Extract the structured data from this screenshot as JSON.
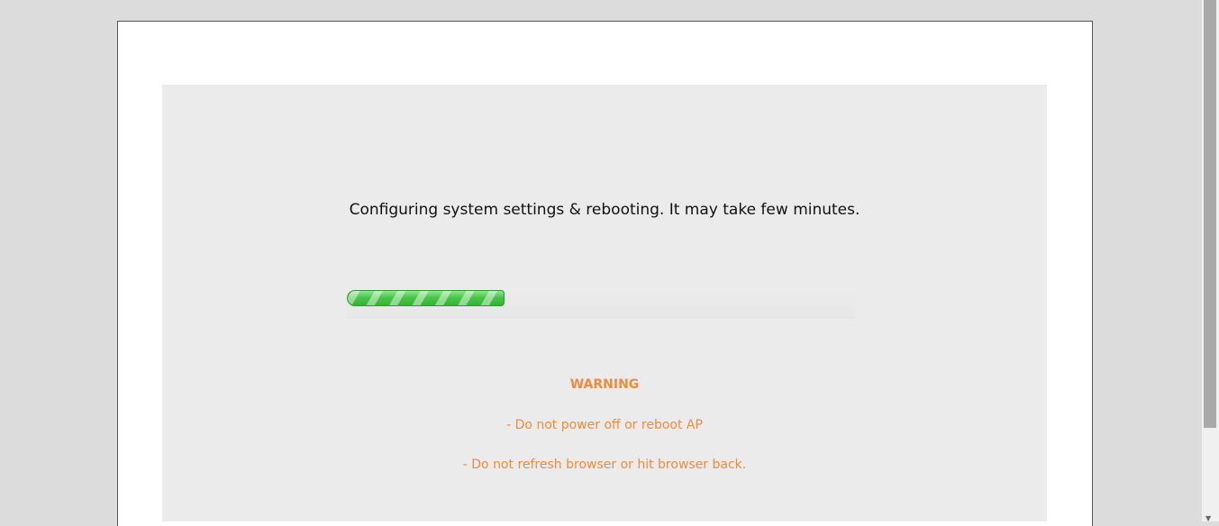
{
  "status": {
    "message": "Configuring system settings & rebooting. It may take few minutes."
  },
  "progress": {
    "fraction": 0.31,
    "color": "#46c346"
  },
  "warning": {
    "title": "WARNING",
    "line1": "- Do not power off or reboot AP",
    "line2": "- Do not refresh browser or hit browser back.",
    "color": "#f08a3c"
  },
  "icons": {
    "scroll_down": "chevron-down-icon"
  }
}
